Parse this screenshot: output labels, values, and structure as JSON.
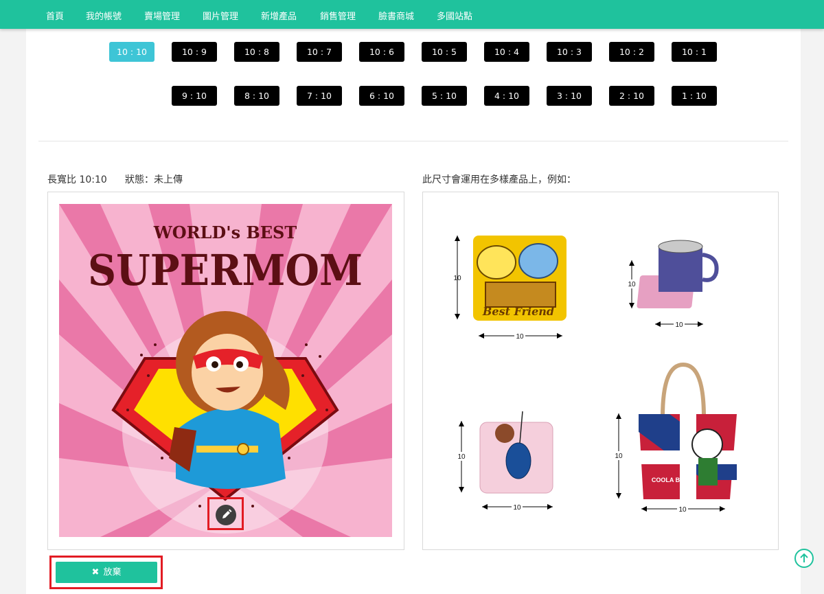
{
  "nav": {
    "items": [
      "首頁",
      "我的帳號",
      "賣場管理",
      "圖片管理",
      "新增產品",
      "銷售管理",
      "臉書商城",
      "多國站點"
    ]
  },
  "ratios": {
    "row1": [
      "10 : 10",
      "10 : 9",
      "10 : 8",
      "10 : 7",
      "10 : 6",
      "10 : 5",
      "10 : 4",
      "10 : 3",
      "10 : 2",
      "10 : 1"
    ],
    "row2": [
      "9 : 10",
      "8 : 10",
      "7 : 10",
      "6 : 10",
      "5 : 10",
      "4 : 10",
      "3 : 10",
      "2 : 10",
      "1 : 10"
    ],
    "active": "10 : 10"
  },
  "upload": {
    "ratio_label": "長寬比 10:10",
    "status_label": "狀態：未上傳",
    "artwork_line1": "WORLD's BEST",
    "artwork_line2": "SUPERMOM",
    "discard_label": "放棄"
  },
  "examples": {
    "heading": "此尺寸會運用在多樣產品上，例如：",
    "dimension": "10",
    "pillow_text": "Best Friend",
    "bag_text": "COOLA BEAR"
  },
  "colors": {
    "brand": "#1fc29d",
    "active_ratio": "#3ec5d6",
    "highlight": "#e21b23"
  },
  "icons": [
    "pencil-icon",
    "times-icon",
    "arrow-up-icon"
  ]
}
